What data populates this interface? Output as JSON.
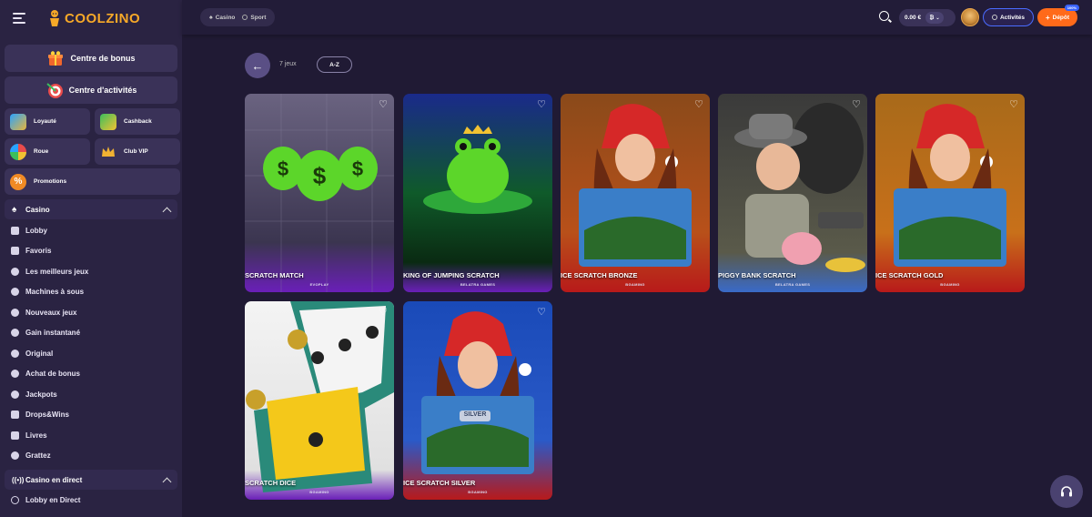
{
  "brand": {
    "name": "COOLZINO",
    "accent": "#f7a928"
  },
  "sidebar": {
    "bonus_center": "Centre de bonus",
    "activity_center": "Centre d'activités",
    "tiles": [
      {
        "label": "Loyauté",
        "icon": "shield-icon"
      },
      {
        "label": "Cashback",
        "icon": "cashback-icon"
      },
      {
        "label": "Roue",
        "icon": "wheel-icon"
      },
      {
        "label": "Club VIP",
        "icon": "crown-icon"
      },
      {
        "label": "Promotions",
        "icon": "percent-icon"
      }
    ],
    "casino_section": "Casino",
    "casino_items": [
      "Lobby",
      "Favoris",
      "Les meilleurs jeux",
      "Machines à sous",
      "Nouveaux jeux",
      "Gain instantané",
      "Original",
      "Achat de bonus",
      "Jackpots",
      "Drops&Wins",
      "Livres",
      "Grattez"
    ],
    "live_section": "Casino en direct",
    "live_items": [
      "Lobby en Direct"
    ]
  },
  "topbar": {
    "tabs": [
      "Casino",
      "Sport"
    ],
    "balance": "0.00 €",
    "currency": "₿",
    "activities": "Activités",
    "deposit": "Dépôt",
    "deposit_badge": "100%",
    "deposit_color": "#ff6a1a"
  },
  "content": {
    "count": "7 jeux",
    "sort": "A-Z"
  },
  "games": [
    {
      "name": "SCRATCH MATCH",
      "provider": "EVOPLAY"
    },
    {
      "name": "KING OF JUMPING SCRATCH",
      "provider": "BELATRA GAMES"
    },
    {
      "name": "ICE SCRATCH BRONZE",
      "provider": "BGAMING"
    },
    {
      "name": "PIGGY BANK SCRATCH",
      "provider": "BELATRA GAMES"
    },
    {
      "name": "ICE SCRATCH GOLD",
      "provider": "BGAMING"
    },
    {
      "name": "SCRATCH DICE",
      "provider": "BGAMING"
    },
    {
      "name": "ICE SCRATCH SILVER",
      "provider": "BGAMING",
      "art_label": "SILVER"
    }
  ]
}
